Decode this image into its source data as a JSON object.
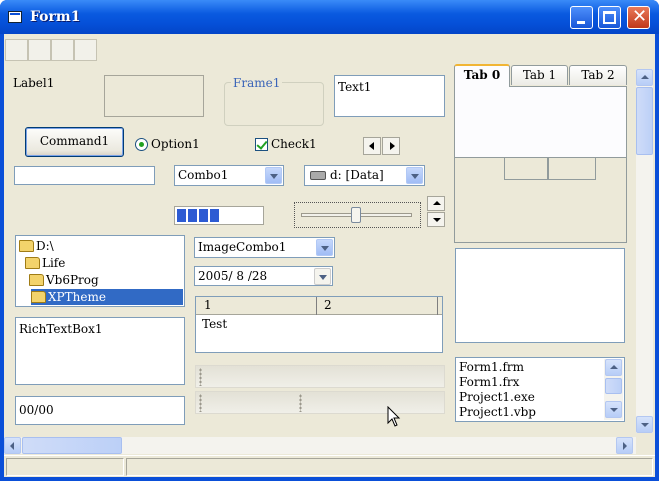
{
  "window": {
    "title": "Form1"
  },
  "controls": {
    "label1": "Label1",
    "frame1": "Frame1",
    "text1": "Text1",
    "command1": "Command1",
    "option1": "Option1",
    "check1": "Check1",
    "combo1": "Combo1",
    "drive": "d: [Data]",
    "image_combo": "ImageCombo1",
    "date": "2005/ 8 /28",
    "rich_text": "RichTextBox1",
    "masked_edit": "00/00",
    "progress_blocks": 4
  },
  "dir_list": {
    "items": [
      "D:\\",
      "Life",
      "Vb6Prog",
      "XPTheme"
    ],
    "selected": "XPTheme"
  },
  "grid": {
    "headers": [
      "1",
      "2"
    ],
    "rows": [
      [
        "Test",
        ""
      ]
    ]
  },
  "tabs": [
    "Tab 0",
    "Tab 1",
    "Tab 2"
  ],
  "file_list": [
    "Form1.frm",
    "Form1.frx",
    "Project1.exe",
    "Project1.vbp"
  ],
  "colors": {
    "title_bar": "#0a4fd8",
    "selection": "#316ac5",
    "progress": "#2d5bd3"
  }
}
